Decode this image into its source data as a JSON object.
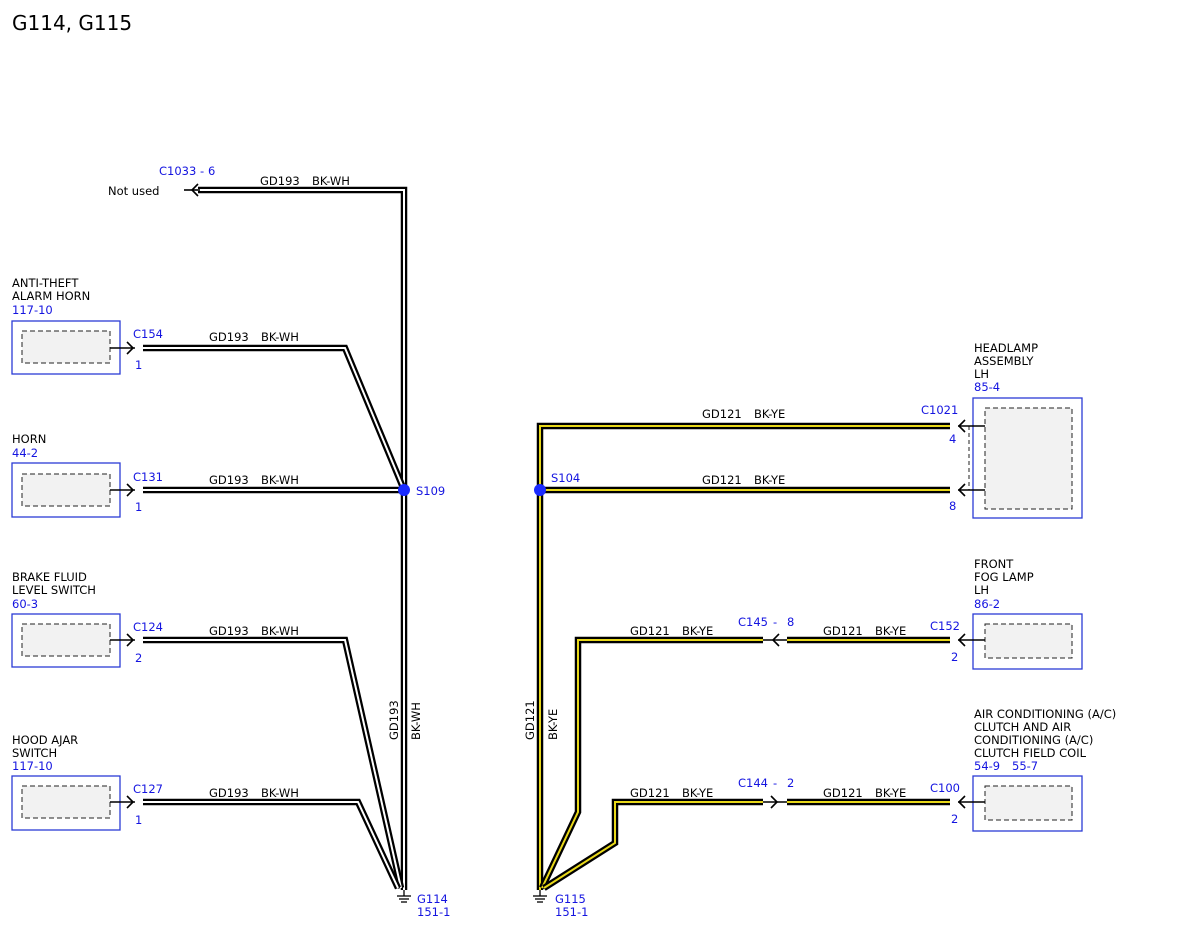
{
  "title": "G114, G115",
  "not_used": "Not used",
  "wire_gd193": "GD193",
  "wire_bkwh": "BK-WH",
  "wire_gd121": "GD121",
  "wire_bkye": "BK-YE",
  "dash": "-",
  "components": {
    "anti_theft": {
      "line1": "ANTI-THEFT",
      "line2": "ALARM HORN",
      "ref": "117-10",
      "connector": "C154",
      "pin": "1"
    },
    "horn": {
      "line1": "HORN",
      "ref": "44-2",
      "connector": "C131",
      "pin": "1"
    },
    "brake_fluid": {
      "line1": "BRAKE FLUID",
      "line2": "LEVEL SWITCH",
      "ref": "60-3",
      "connector": "C124",
      "pin": "2"
    },
    "hood_ajar": {
      "line1": "HOOD AJAR",
      "line2": "SWITCH",
      "ref": "117-10",
      "connector": "C127",
      "pin": "1"
    },
    "headlamp": {
      "line1": "HEADLAMP",
      "line2": "ASSEMBLY",
      "line3": "LH",
      "ref": "85-4",
      "connector": "C1021",
      "pin_top": "4",
      "pin_bottom": "8"
    },
    "fog_lamp": {
      "line1": "FRONT",
      "line2": "FOG LAMP",
      "line3": "LH",
      "ref": "86-2",
      "connector": "C152",
      "pin": "2"
    },
    "ac_clutch": {
      "line1": "AIR CONDITIONING (A/C)",
      "line2": "CLUTCH AND AIR",
      "line3": "CONDITIONING (A/C)",
      "line4": "CLUTCH FIELD COIL",
      "ref1": "54-9",
      "ref2": "55-7",
      "connector": "C100",
      "pin": "2"
    }
  },
  "connectors": {
    "c1033": {
      "name": "C1033",
      "pin": "6"
    },
    "c145": {
      "name": "C145",
      "pin": "8"
    },
    "c144": {
      "name": "C144",
      "pin": "2"
    }
  },
  "splices": {
    "s109": "S109",
    "s104": "S104"
  },
  "grounds": {
    "g114": {
      "name": "G114",
      "ref": "151-1"
    },
    "g115": {
      "name": "G115",
      "ref": "151-1"
    }
  },
  "colors": {
    "connector_blue": "#1414e0",
    "splice_blue": "#1a2bff",
    "wire_black": "#000000",
    "wire_yellow": "#e8d81a"
  }
}
